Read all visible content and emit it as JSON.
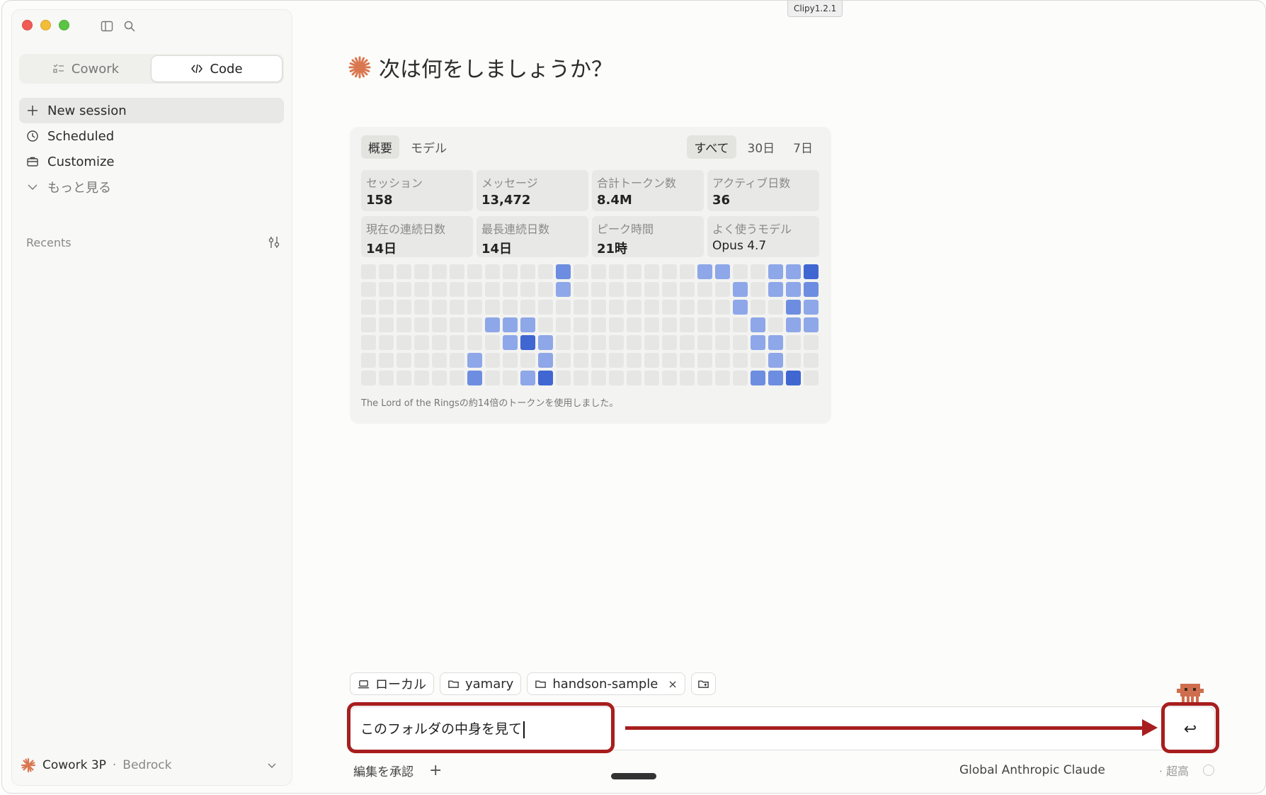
{
  "clipy_label": "Clipy1.2.1",
  "sidebar": {
    "mode_tabs": [
      {
        "label": "Cowork",
        "icon": "checklist-icon"
      },
      {
        "label": "Code",
        "icon": "code-icon"
      }
    ],
    "nav": [
      {
        "label": "New session",
        "icon": "plus-icon"
      },
      {
        "label": "Scheduled",
        "icon": "clock-icon"
      },
      {
        "label": "Customize",
        "icon": "briefcase-icon"
      },
      {
        "label": "もっと見る",
        "icon": "chevron-down-icon"
      }
    ],
    "recents_label": "Recents",
    "account": {
      "name": "Cowork 3P",
      "separator": "·",
      "provider": "Bedrock"
    }
  },
  "greeting": "次は何をしましょうか？",
  "stats": {
    "tabs_left": [
      "概要",
      "モデル"
    ],
    "tabs_right": [
      "すべて",
      "30日",
      "7日"
    ],
    "cards": [
      {
        "label": "セッション",
        "value": "158"
      },
      {
        "label": "メッセージ",
        "value": "13,472"
      },
      {
        "label": "合計トークン数",
        "value": "8.4M"
      },
      {
        "label": "アクティブ日数",
        "value": "36"
      },
      {
        "label": "現在の連続日数",
        "value": "14日"
      },
      {
        "label": "最長連続日数",
        "value": "14日"
      },
      {
        "label": "ピーク時間",
        "value": "21時"
      },
      {
        "label": "よく使うモデル",
        "value": "Opus 4.7"
      }
    ],
    "footnote": "The Lord of the Ringsの約14倍のトークンを使用しました。",
    "heatmap_colors": {
      "empty": "#e6e6e4",
      "l1": "#8ea7e8",
      "l2": "#6d8de0",
      "l3": "#3f66d1"
    }
  },
  "chips": [
    {
      "label": "ローカル",
      "icon": "laptop-icon"
    },
    {
      "label": "yamary",
      "icon": "folder-icon"
    },
    {
      "label": "handson-sample",
      "icon": "folder-icon",
      "close": "×"
    }
  ],
  "composer": {
    "text": "このフォルダの中身を見て",
    "send_icon": "↩"
  },
  "bottom": {
    "accept_edits": "編集を承認",
    "add": "+",
    "model": "Global Anthropic Claude",
    "effort": "· 超高"
  },
  "accent_color": "#d9774f",
  "highlight_color": "#a81e1e"
}
